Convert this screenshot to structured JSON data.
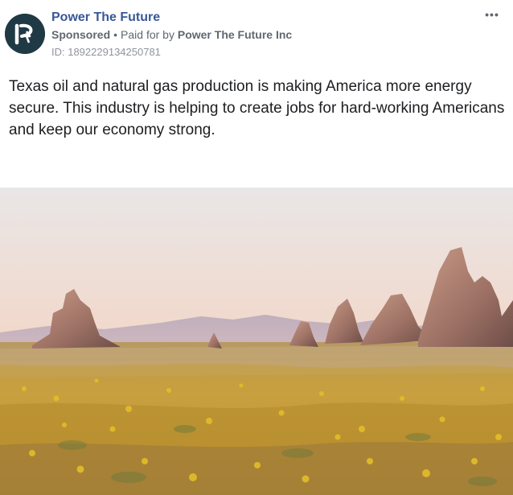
{
  "post": {
    "page_name": "Power The Future",
    "sponsored_label": "Sponsored",
    "separator": "•",
    "paid_for_prefix": "Paid for by",
    "paid_for_by": "Power The Future Inc",
    "ad_id": "ID: 1892229134250781",
    "more_options": "•••",
    "body_text": "Texas oil and natural gas production is making America more energy secure. This industry is helping to create jobs for hard-working Americans and keep our economy strong.",
    "avatar_icon": "power-the-future-logo-icon",
    "image_icon": "desert-landscape-photo"
  },
  "colors": {
    "page_name": "#385898",
    "meta_text": "#606770",
    "id_text": "#90949c",
    "body_text": "#1c1e21",
    "avatar_bg": "#1f3a44"
  }
}
